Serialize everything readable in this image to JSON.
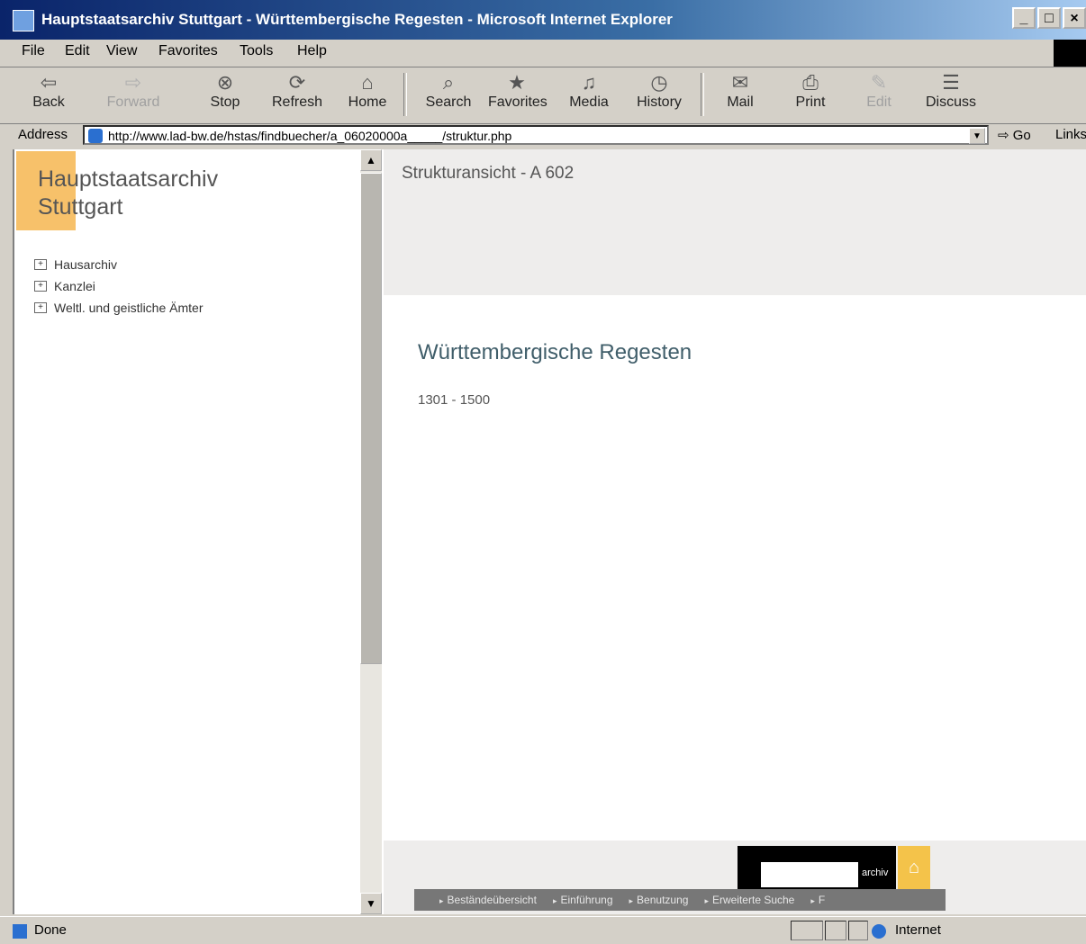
{
  "window": {
    "title": "Hauptstaatsarchiv Stuttgart - Württembergische Regesten - Microsoft Internet Explorer",
    "buttons": [
      "_",
      "□",
      "×"
    ]
  },
  "menu": [
    "File",
    "Edit",
    "View",
    "Favorites",
    "Tools",
    "Help"
  ],
  "toolbar": {
    "buttons": [
      {
        "label": "Back",
        "icon": "back-arrow-icon",
        "glyph": "⇦",
        "enabled": true
      },
      {
        "label": "Forward",
        "icon": "forward-arrow-icon",
        "glyph": "⇨",
        "enabled": false
      },
      {
        "label": "Stop",
        "icon": "stop-icon",
        "glyph": "⊗",
        "enabled": true
      },
      {
        "label": "Refresh",
        "icon": "refresh-icon",
        "glyph": "⟳",
        "enabled": true
      },
      {
        "label": "Home",
        "icon": "home-icon",
        "glyph": "⌂",
        "enabled": true
      },
      {
        "label": "Search",
        "icon": "search-icon",
        "glyph": "⌕",
        "enabled": true
      },
      {
        "label": "Favorites",
        "icon": "favorites-icon",
        "glyph": "★",
        "enabled": true
      },
      {
        "label": "Media",
        "icon": "media-icon",
        "glyph": "♫",
        "enabled": true
      },
      {
        "label": "History",
        "icon": "history-icon",
        "glyph": "◷",
        "enabled": true
      },
      {
        "label": "Mail",
        "icon": "mail-icon",
        "glyph": "✉",
        "enabled": true
      },
      {
        "label": "Print",
        "icon": "print-icon",
        "glyph": "⎙",
        "enabled": true
      },
      {
        "label": "Edit",
        "icon": "edit-icon",
        "glyph": "✎",
        "enabled": false
      },
      {
        "label": "Discuss",
        "icon": "discuss-icon",
        "glyph": "☰",
        "enabled": true
      }
    ]
  },
  "address": {
    "label": "Address",
    "url": "http://www.lad-bw.de/hstas/findbuecher/a_06020000a_____/struktur.php",
    "go": "Go",
    "links": "Links"
  },
  "left": {
    "org_line1": "Hauptstaatsarchiv",
    "org_line2": "Stuttgart",
    "tree": [
      "Hausarchiv",
      "Kanzlei",
      "Weltl. und geistliche Ämter"
    ]
  },
  "right": {
    "struct_label": "Strukturansicht - A 602",
    "title": "Württembergische Regesten",
    "date_range": "1301 - 1500",
    "footer_black_label": "archiv",
    "footer_nav": [
      "Beständeübersicht",
      "Einführung",
      "Benutzung",
      "Erweiterte Suche",
      "F"
    ]
  },
  "status": {
    "text": "Done",
    "zone": "Internet"
  },
  "colors": {
    "accent": "#f7c16a",
    "title_text": "#405e6a",
    "titlebar": "#0a246a"
  }
}
